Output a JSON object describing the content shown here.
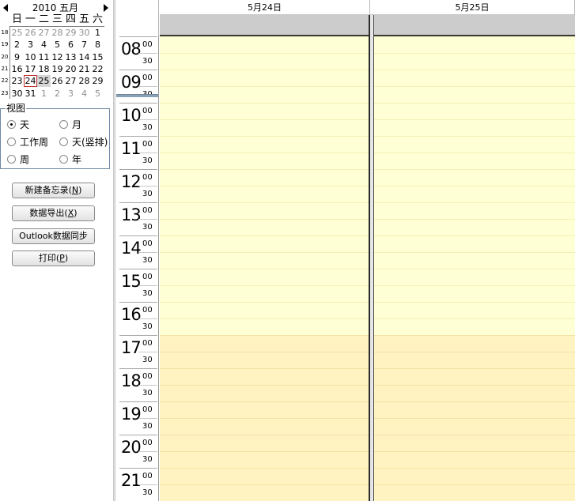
{
  "calendar": {
    "title": "2010 五月",
    "weekdays": [
      "日",
      "一",
      "二",
      "三",
      "四",
      "五",
      "六"
    ],
    "weeks": [
      {
        "num": "18",
        "days": [
          {
            "d": "25",
            "o": true
          },
          {
            "d": "26",
            "o": true
          },
          {
            "d": "27",
            "o": true
          },
          {
            "d": "28",
            "o": true
          },
          {
            "d": "29",
            "o": true
          },
          {
            "d": "30",
            "o": true
          },
          {
            "d": "1",
            "o": false
          }
        ]
      },
      {
        "num": "19",
        "days": [
          {
            "d": "2",
            "o": false
          },
          {
            "d": "3",
            "o": false
          },
          {
            "d": "4",
            "o": false
          },
          {
            "d": "5",
            "o": false
          },
          {
            "d": "6",
            "o": false
          },
          {
            "d": "7",
            "o": false
          },
          {
            "d": "8",
            "o": false
          }
        ]
      },
      {
        "num": "20",
        "days": [
          {
            "d": "9",
            "o": false
          },
          {
            "d": "10",
            "o": false
          },
          {
            "d": "11",
            "o": false
          },
          {
            "d": "12",
            "o": false
          },
          {
            "d": "13",
            "o": false
          },
          {
            "d": "14",
            "o": false
          },
          {
            "d": "15",
            "o": false
          }
        ]
      },
      {
        "num": "21",
        "days": [
          {
            "d": "16",
            "o": false
          },
          {
            "d": "17",
            "o": false
          },
          {
            "d": "18",
            "o": false
          },
          {
            "d": "19",
            "o": false
          },
          {
            "d": "20",
            "o": false
          },
          {
            "d": "21",
            "o": false
          },
          {
            "d": "22",
            "o": false
          }
        ]
      },
      {
        "num": "22",
        "days": [
          {
            "d": "23",
            "o": false
          },
          {
            "d": "24",
            "o": false,
            "today": true
          },
          {
            "d": "25",
            "o": false,
            "sel": true
          },
          {
            "d": "26",
            "o": false
          },
          {
            "d": "27",
            "o": false
          },
          {
            "d": "28",
            "o": false
          },
          {
            "d": "29",
            "o": false
          }
        ]
      },
      {
        "num": "23",
        "days": [
          {
            "d": "30",
            "o": false
          },
          {
            "d": "31",
            "o": false
          },
          {
            "d": "1",
            "o": true
          },
          {
            "d": "2",
            "o": true
          },
          {
            "d": "3",
            "o": true
          },
          {
            "d": "4",
            "o": true
          },
          {
            "d": "5",
            "o": true
          }
        ]
      }
    ]
  },
  "view": {
    "legend": "视图",
    "options": [
      {
        "label": "天",
        "checked": true
      },
      {
        "label": "月",
        "checked": false
      },
      {
        "label": "工作周",
        "checked": false
      },
      {
        "label": "天(竖排)",
        "checked": false
      },
      {
        "label": "周",
        "checked": false
      },
      {
        "label": "年",
        "checked": false
      }
    ]
  },
  "buttons": [
    {
      "label": "新建备忘录(",
      "key": "N",
      "suffix": ")"
    },
    {
      "label": "数据导出(",
      "key": "X",
      "suffix": ")"
    },
    {
      "label": "Outlook数据同步",
      "key": "",
      "suffix": ""
    },
    {
      "label": "打印(",
      "key": "P",
      "suffix": ")"
    }
  ],
  "days": [
    {
      "label": "5月24日"
    },
    {
      "label": "5月25日"
    }
  ],
  "hours": [
    "08",
    "09",
    "10",
    "11",
    "12",
    "13",
    "14",
    "15",
    "16",
    "17",
    "18",
    "19",
    "20",
    "21"
  ],
  "minutes": {
    "top": "00",
    "half": "30"
  },
  "colors": {
    "work_hours": "#ffffd5",
    "work_lines": "#f0f0b8",
    "after_hours": "#fff4c1",
    "after_lines": "#f2e2a6"
  }
}
